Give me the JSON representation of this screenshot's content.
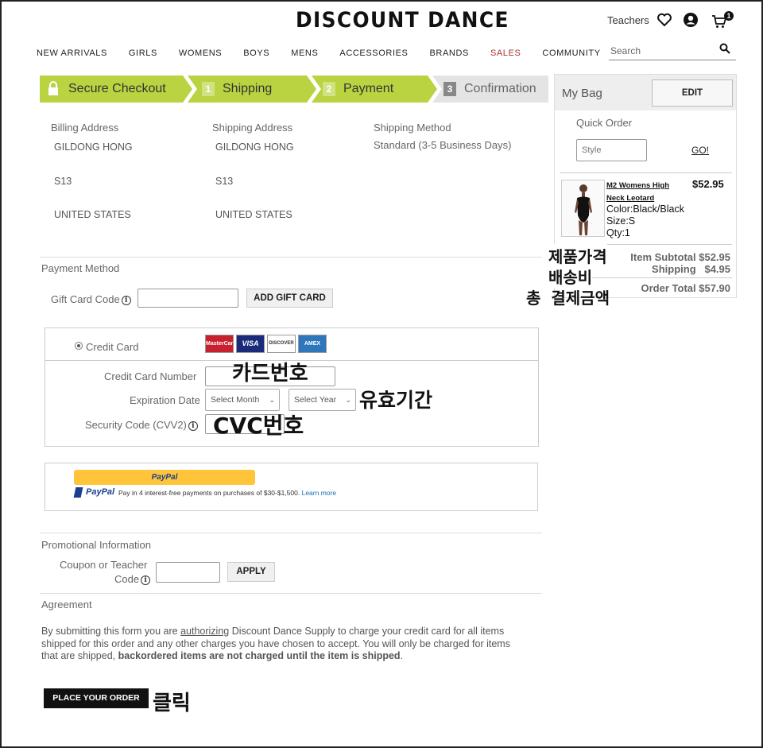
{
  "header": {
    "logo": "DISCOUNT DANCE",
    "teachers": "Teachers",
    "cart_count": "1",
    "search_placeholder": "Search",
    "nav": [
      "NEW ARRIVALS",
      "GIRLS",
      "WOMENS",
      "BOYS",
      "MENS",
      "ACCESSORIES",
      "BRANDS",
      "SALES",
      "COMMUNITY"
    ]
  },
  "steps": {
    "secure": "Secure Checkout",
    "shipping": {
      "num": "1",
      "label": "Shipping"
    },
    "payment": {
      "num": "2",
      "label": "Payment"
    },
    "confirmation": {
      "num": "3",
      "label": "Confirmation"
    }
  },
  "addresses": {
    "billing": {
      "heading": "Billing Address",
      "name": "GILDONG HONG",
      "line": "S13",
      "country": "UNITED STATES"
    },
    "shipping": {
      "heading": "Shipping Address",
      "name": "GILDONG HONG",
      "line": "S13",
      "country": "UNITED STATES"
    },
    "method": {
      "heading": "Shipping Method",
      "value": "Standard (3-5 Business Days)"
    }
  },
  "payment": {
    "heading": "Payment Method",
    "gift_label": "Gift Card Code",
    "gift_button": "ADD GIFT CARD",
    "credit_card_label": "Credit Card",
    "card_logos": [
      "MasterCard",
      "VISA",
      "DISCOVER",
      "AMEX"
    ],
    "card_number_label": "Credit Card Number",
    "expiration_label": "Expiration Date",
    "month_placeholder": "Select Month",
    "year_placeholder": "Select Year",
    "cvv_label": "Security Code (CVV2)"
  },
  "paypal": {
    "button": "PayPal",
    "brand": "PayPal",
    "message": "Pay in 4 interest-free payments on purchases of $30-$1,500.",
    "learn_more": "Learn more"
  },
  "promo": {
    "heading": "Promotional Information",
    "coupon_label_1": "Coupon or Teacher",
    "coupon_label_2": "Code",
    "apply": "APPLY"
  },
  "agreement": {
    "heading": "Agreement",
    "text_1": "By submitting this form you are ",
    "text_authorizing": "authorizing",
    "text_2": " Discount Dance Supply to charge your credit card for all items shipped for this order and any other charges you have chosen to accept. You will only be charged for items that are shipped, ",
    "text_bold": "backordered items are not charged until the item is shipped",
    "text_end": ".",
    "place_order": "PLACE YOUR ORDER"
  },
  "bag": {
    "title": "My Bag",
    "edit": "EDIT",
    "quick_order": "Quick Order",
    "style_placeholder": "Style",
    "go": "GO!",
    "item": {
      "name_1": "M2 Womens High",
      "name_2": "Neck Leotard",
      "price": "$52.95",
      "color": "Color:Black/Black",
      "size": "Size:S",
      "qty": "Qty:1"
    },
    "subtotal": "Item Subtotal $52.95",
    "shipping": "Shipping   $4.95",
    "total": "Order Total $57.90"
  },
  "annotations": {
    "card_number": "카드번호",
    "expiry": "유효기간",
    "cvc": "CVC번호",
    "click": "클릭",
    "product_price": "제품가격",
    "shipping_fee": "배송비",
    "total_payment": "총 결제금액"
  }
}
